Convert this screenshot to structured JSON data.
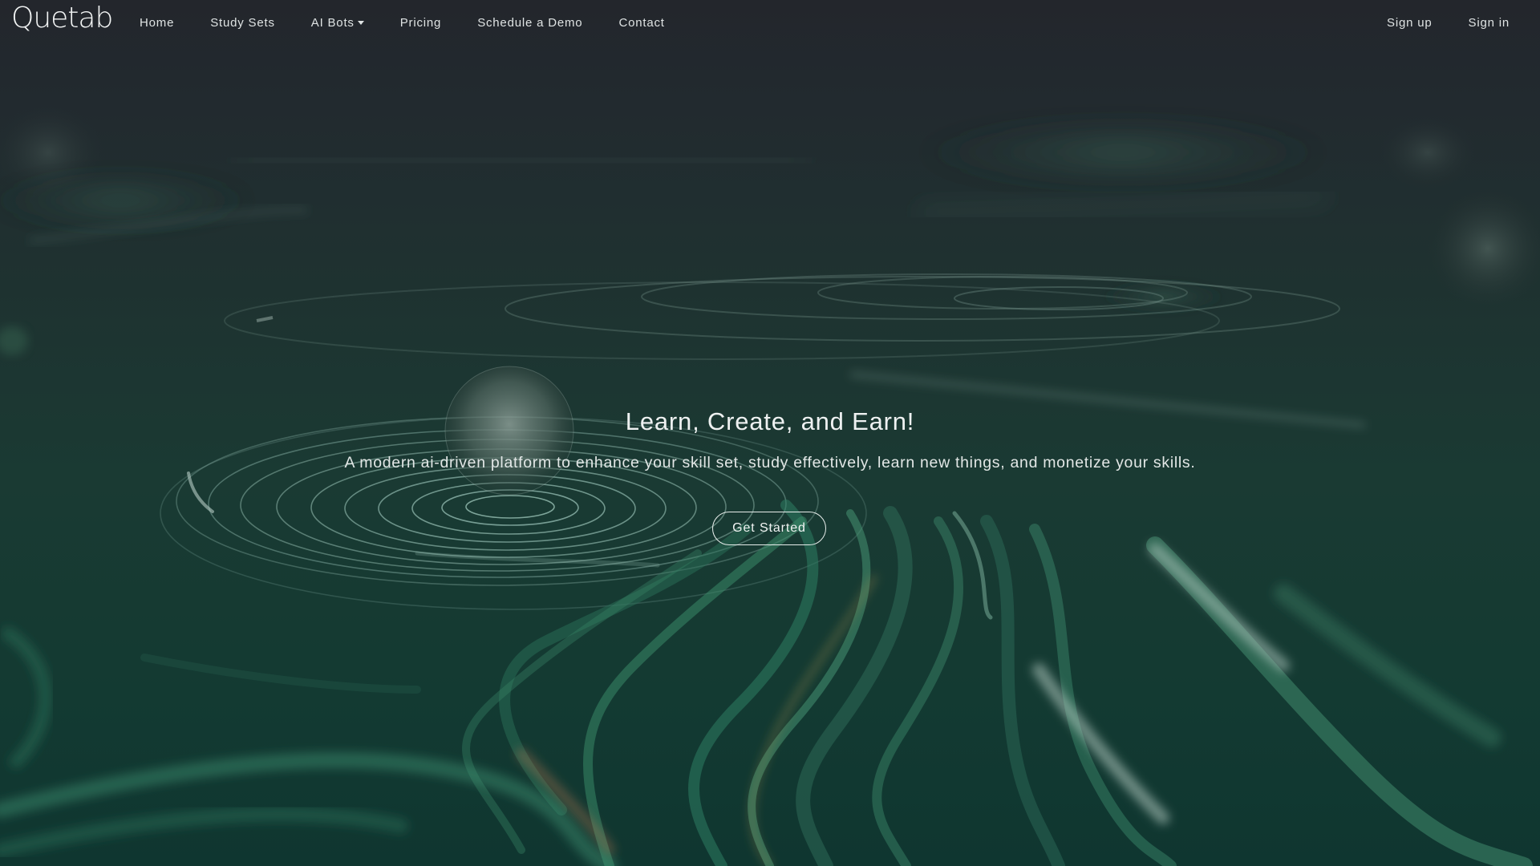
{
  "brand": {
    "name": "Quetab"
  },
  "nav": {
    "links": [
      {
        "label": "Home"
      },
      {
        "label": "Study Sets"
      },
      {
        "label": "AI Bots",
        "has_dropdown": true,
        "icon": "caret-down-icon"
      },
      {
        "label": "Pricing"
      },
      {
        "label": "Schedule a Demo"
      },
      {
        "label": "Contact"
      }
    ],
    "right": [
      {
        "label": "Sign up"
      },
      {
        "label": "Sign in"
      }
    ]
  },
  "hero": {
    "title": "Learn, Create, and Earn!",
    "subtitle": "A modern ai-driven platform to enhance your skill set, study effectively, learn new things, and monetize your skills.",
    "cta_label": "Get Started"
  },
  "colors": {
    "background_top": "#23262c",
    "background_bottom": "#0f3630",
    "accent_green": "#3f9e7a",
    "text": "#eef1f1"
  }
}
